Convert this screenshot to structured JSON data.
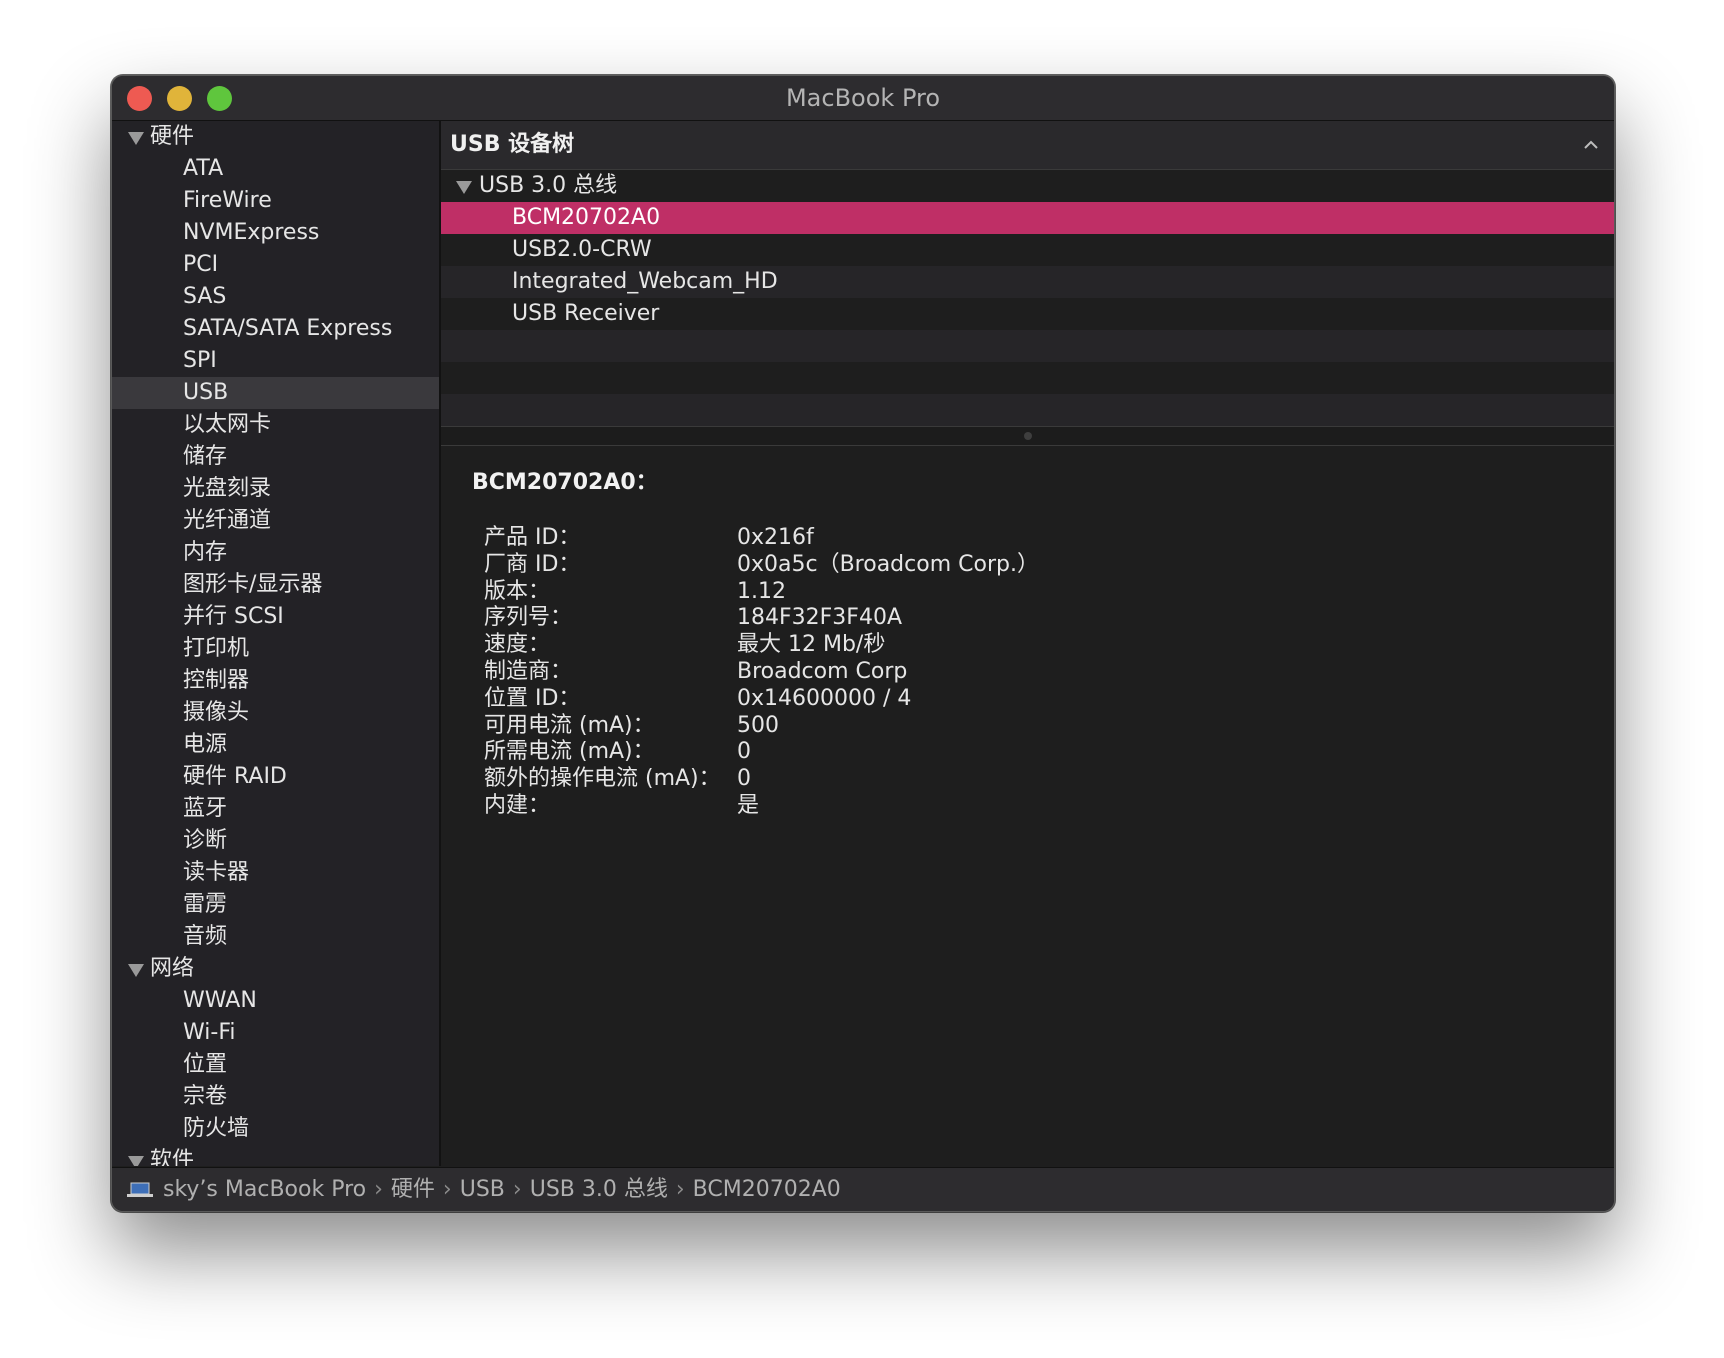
{
  "window": {
    "title": "MacBook Pro"
  },
  "sidebar": {
    "hardware_group": "硬件",
    "hardware_items": [
      "ATA",
      "FireWire",
      "NVMExpress",
      "PCI",
      "SAS",
      "SATA/SATA Express",
      "SPI",
      "USB",
      "以太网卡",
      "储存",
      "光盘刻录",
      "光纤通道",
      "内存",
      "图形卡/显示器",
      "并行 SCSI",
      "打印机",
      "控制器",
      "摄像头",
      "电源",
      "硬件 RAID",
      "蓝牙",
      "诊断",
      "读卡器",
      "雷雳",
      "音频"
    ],
    "network_group": "网络",
    "network_items": [
      "WWAN",
      "Wi-Fi",
      "位置",
      "宗卷",
      "防火墙"
    ],
    "software_group": "软件",
    "selected": "USB"
  },
  "pane": {
    "header_title": "USB 设备树",
    "tree": {
      "bus": "USB 3.0 总线",
      "devices": [
        "BCM20702A0",
        "USB2.0-CRW",
        "Integrated_Webcam_HD",
        "USB Receiver"
      ],
      "selected": "BCM20702A0"
    }
  },
  "detail": {
    "title": "BCM20702A0：",
    "properties": [
      {
        "key": "产品 ID：",
        "value": "0x216f"
      },
      {
        "key": "厂商 ID：",
        "value": "0x0a5c（Broadcom Corp.）"
      },
      {
        "key": "版本：",
        "value": "1.12"
      },
      {
        "key": "序列号：",
        "value": "184F32F3F40A"
      },
      {
        "key": "速度：",
        "value": "最大 12 Mb/秒"
      },
      {
        "key": "制造商：",
        "value": "Broadcom Corp"
      },
      {
        "key": "位置 ID：",
        "value": "0x14600000 / 4"
      },
      {
        "key": "可用电流 (mA)：",
        "value": "500"
      },
      {
        "key": "所需电流 (mA)：",
        "value": "0"
      },
      {
        "key": "额外的操作电流 (mA)：",
        "value": "0"
      },
      {
        "key": "内建：",
        "value": "是"
      }
    ]
  },
  "statusbar": {
    "breadcrumbs": [
      "sky’s MacBook Pro",
      "硬件",
      "USB",
      "USB 3.0 总线",
      "BCM20702A0"
    ],
    "separator": "›"
  },
  "colors": {
    "selection": "#bf2f66",
    "close": "#ee5a52",
    "minimize": "#e0b43a",
    "maximize": "#5fc63d"
  }
}
